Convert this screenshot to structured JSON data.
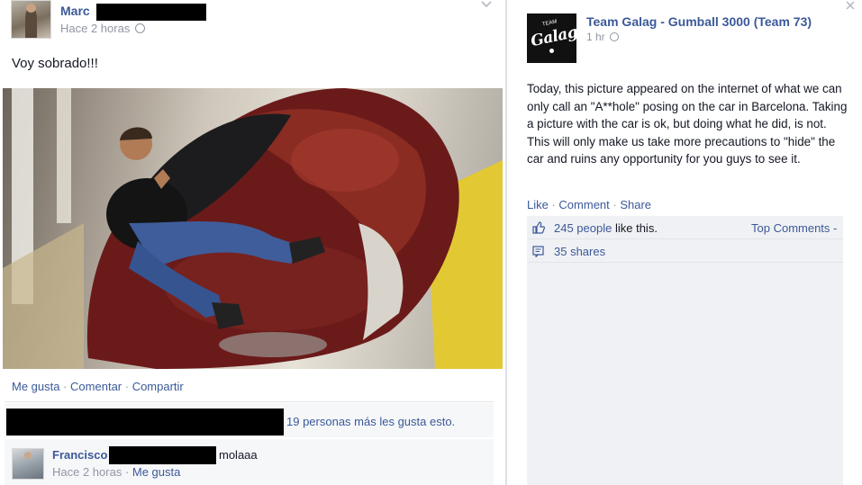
{
  "left_post": {
    "author": "Marc",
    "timestamp": "Hace 2 horas",
    "status": "Voy sobrado!!!",
    "actions": [
      "Me gusta",
      "Comentar",
      "Compartir"
    ],
    "likes_text": "19 personas más les gusta esto.",
    "comment": {
      "author": "Francisco",
      "text": "molaaa",
      "timestamp": "Hace 2 horas",
      "like_action": "Me gusta"
    }
  },
  "right_post": {
    "page_name": "Team Galag - Gumball 3000 (Team 73)",
    "timestamp": "1 hr",
    "logo_text": "Galag",
    "logo_small": "TEAM",
    "body": "Today, this picture appeared on the internet of what we can only call an \"A**hole\" posing on the car in Barcelona. Taking a picture with the car is ok, but doing what he did, is not. This will only make us take more precautions to \"hide\" the car and ruins any opportunity for you guys to see it.",
    "actions": [
      "Like",
      "Comment",
      "Share"
    ],
    "like_count": "245 people",
    "like_suffix": "like this.",
    "top_comments": "Top Comments",
    "shares": "35 shares"
  },
  "separator": " · ",
  "colors": {
    "link": "#3b5998",
    "muted": "#9197a3",
    "ufi_bg": "#f0f1f4"
  }
}
